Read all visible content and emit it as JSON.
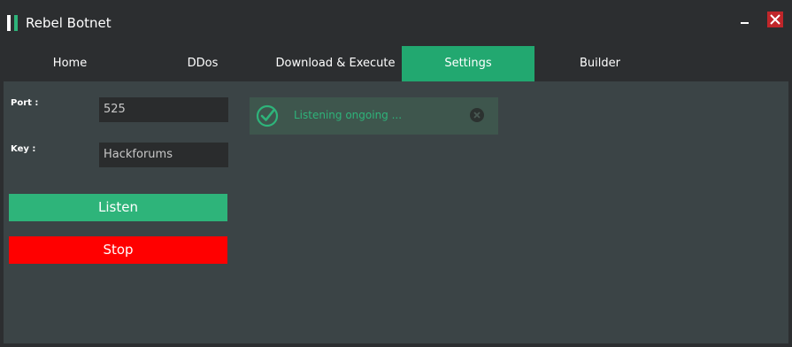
{
  "window": {
    "title": "Rebel Botnet",
    "logo_icon": "app-logo-icon",
    "accent_color": "#2eb47a",
    "close_color": "#c0262a"
  },
  "tabs": [
    {
      "label": "Home",
      "active": false
    },
    {
      "label": "DDos",
      "active": false
    },
    {
      "label": "Download & Execute",
      "active": false
    },
    {
      "label": "Settings",
      "active": true
    },
    {
      "label": "Builder",
      "active": false
    }
  ],
  "settings": {
    "port_label": "Port :",
    "port_value": "525",
    "key_label": "Key :",
    "key_value": "Hackforums",
    "listen_label": "Listen",
    "stop_label": "Stop",
    "listen_color": "#2eb47a",
    "stop_color": "#ff0000"
  },
  "notification": {
    "message": "Listening ongoing ...",
    "icon": "check-circle-icon",
    "dismiss_icon": "close-circle-icon"
  }
}
